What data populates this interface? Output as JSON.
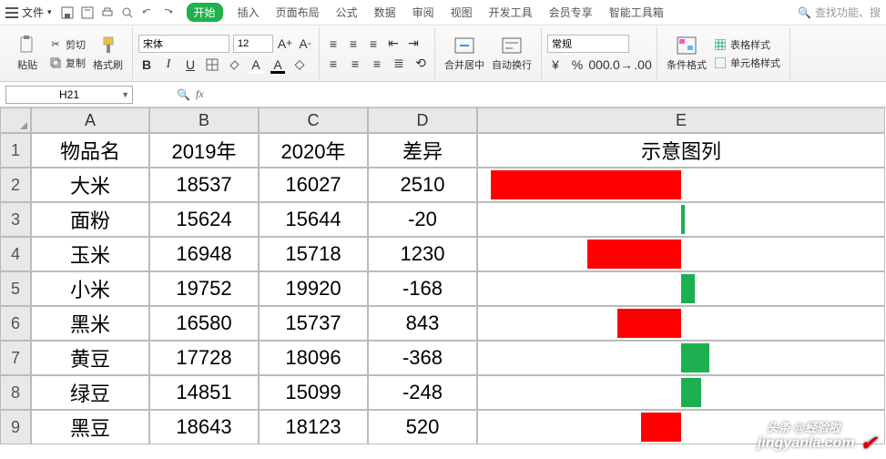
{
  "menu": {
    "file": "文件",
    "tabs": [
      "开始",
      "插入",
      "页面布局",
      "公式",
      "数据",
      "审阅",
      "视图",
      "开发工具",
      "会员专享",
      "智能工具箱"
    ],
    "active_index": 0,
    "search_placeholder": "查找功能、搜"
  },
  "ribbon": {
    "paste": "粘贴",
    "cut": "剪切",
    "copy": "复制",
    "format_painter": "格式刷",
    "font_name": "宋体",
    "font_size": "12",
    "merge_center": "合并居中",
    "wrap_text": "自动换行",
    "number_format": "常规",
    "conditional_format": "条件格式",
    "table_style": "表格样式",
    "cell_style": "单元格样式"
  },
  "formula_bar": {
    "name_box": "H21",
    "formula": ""
  },
  "columns": [
    "A",
    "B",
    "C",
    "D",
    "E"
  ],
  "header_row": [
    "物品名",
    "2019年",
    "2020年",
    "差异",
    "示意图列"
  ],
  "rows": [
    {
      "n": "2",
      "a": "大米",
      "b": "18537",
      "c": "16027",
      "d": "2510",
      "bar": {
        "dir": "red",
        "pct": 95
      }
    },
    {
      "n": "3",
      "a": "面粉",
      "b": "15624",
      "c": "15644",
      "d": "-20",
      "bar": {
        "dir": "green",
        "pct": 2
      }
    },
    {
      "n": "4",
      "a": "玉米",
      "b": "16948",
      "c": "15718",
      "d": "1230",
      "bar": {
        "dir": "red",
        "pct": 47
      }
    },
    {
      "n": "5",
      "a": "小米",
      "b": "19752",
      "c": "19920",
      "d": "-168",
      "bar": {
        "dir": "green",
        "pct": 7
      }
    },
    {
      "n": "6",
      "a": "黑米",
      "b": "16580",
      "c": "15737",
      "d": "843",
      "bar": {
        "dir": "red",
        "pct": 32
      }
    },
    {
      "n": "7",
      "a": "黄豆",
      "b": "17728",
      "c": "18096",
      "d": "-368",
      "bar": {
        "dir": "green",
        "pct": 14
      }
    },
    {
      "n": "8",
      "a": "绿豆",
      "b": "14851",
      "c": "15099",
      "d": "-248",
      "bar": {
        "dir": "green",
        "pct": 10
      }
    },
    {
      "n": "9",
      "a": "黑豆",
      "b": "18643",
      "c": "18123",
      "d": "520",
      "bar": {
        "dir": "red",
        "pct": 20
      }
    }
  ],
  "watermark": {
    "top": "头条 @经验啦",
    "bottom": "jingyanla.com"
  }
}
